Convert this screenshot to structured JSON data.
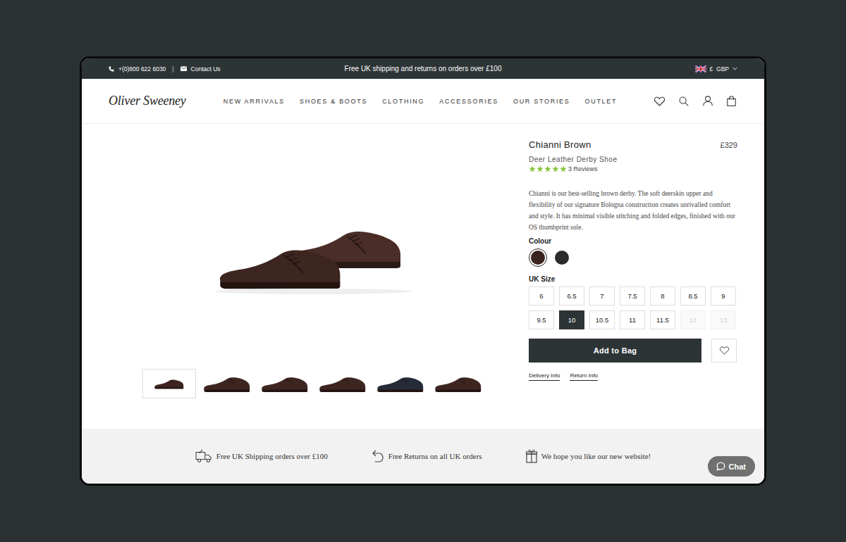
{
  "top_bar": {
    "phone": "+(0)800 622 6030",
    "separator": "|",
    "contact": "Contact Us",
    "promo": "Free UK shipping and returns on orders over £100",
    "currency": "£  GBP"
  },
  "header": {
    "logo": "Oliver Sweeney",
    "nav": [
      "NEW ARRIVALS",
      "SHOES & BOOTS",
      "CLOTHING",
      "ACCESSORIES",
      "OUR STORIES",
      "OUTLET"
    ]
  },
  "gallery": {
    "thumbnails": [
      {
        "selected": true
      },
      {
        "selected": false
      },
      {
        "selected": false
      },
      {
        "selected": false
      },
      {
        "selected": false
      },
      {
        "selected": false
      }
    ]
  },
  "product": {
    "title": "Chianni Brown",
    "price": "£329",
    "subtitle": "Deer Leather Derby Shoe",
    "stars": 5,
    "reviews": "3 Reviews",
    "description": "Chianni is our best-selling brown derby. The soft deerskin upper and flexibility of our signature Bologna construction creates unrivalled comfort and style. It has minimal visible stitching and folded edges, finished with our OS thumbprint sole.",
    "colour_label": "Colour",
    "colours": [
      {
        "color": "#3b2420",
        "selected": true
      },
      {
        "color": "#2b2b2b",
        "selected": false
      }
    ],
    "size_label": "UK Size",
    "sizes": [
      {
        "label": "6",
        "selected": false,
        "disabled": false
      },
      {
        "label": "6.5",
        "selected": false,
        "disabled": false
      },
      {
        "label": "7",
        "selected": false,
        "disabled": false
      },
      {
        "label": "7.5",
        "selected": false,
        "disabled": false
      },
      {
        "label": "8",
        "selected": false,
        "disabled": false
      },
      {
        "label": "8.5",
        "selected": false,
        "disabled": false
      },
      {
        "label": "9",
        "selected": false,
        "disabled": false
      },
      {
        "label": "9.5",
        "selected": false,
        "disabled": false
      },
      {
        "label": "10",
        "selected": true,
        "disabled": false
      },
      {
        "label": "10.5",
        "selected": false,
        "disabled": false
      },
      {
        "label": "11",
        "selected": false,
        "disabled": false
      },
      {
        "label": "11.5",
        "selected": false,
        "disabled": false
      },
      {
        "label": "12",
        "selected": false,
        "disabled": true
      },
      {
        "label": "13",
        "selected": false,
        "disabled": true
      }
    ],
    "add_to_bag": "Add to Bag",
    "links": [
      "Delivery Info",
      "Return Info"
    ]
  },
  "footer": {
    "features": [
      "Free UK Shipping orders over £100",
      "Free Returns on all UK orders",
      "We hope you like our new website!"
    ]
  },
  "chat": {
    "label": "Chat"
  }
}
